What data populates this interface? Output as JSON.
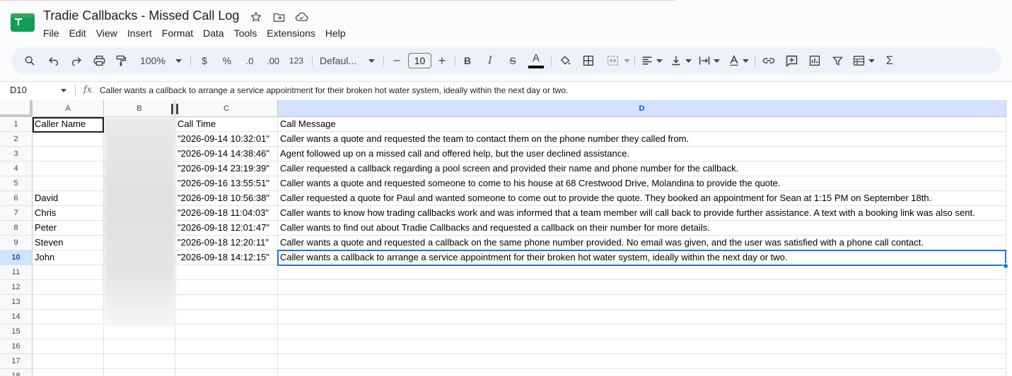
{
  "doc": {
    "title": "Tradie Callbacks - Missed Call Log"
  },
  "menu": [
    "File",
    "Edit",
    "View",
    "Insert",
    "Format",
    "Data",
    "Tools",
    "Extensions",
    "Help"
  ],
  "toolbar": {
    "zoom": "100%",
    "currency": "$",
    "percent": "%",
    "dec_decrease": ".0",
    "dec_increase": ".00",
    "number_format": "123",
    "font": "Defaul...",
    "font_size": "10",
    "minus": "–",
    "plus": "+",
    "bold": "B",
    "italic": "I",
    "strike": "S",
    "text_color": "A",
    "sum": "Σ"
  },
  "formula_bar": {
    "cell_ref": "D10",
    "fx": "fx",
    "content": "Caller wants a callback to arrange a service appointment for their broken hot water system, ideally within the next day or two."
  },
  "columns": [
    "A",
    "B",
    "C",
    "D"
  ],
  "rows": [
    {
      "num": "1",
      "a": "Caller Name",
      "c": "Call Time",
      "d": "Call Message"
    },
    {
      "num": "2",
      "a": "",
      "c": "\"2026-09-14 10:32:01\"",
      "d": "Caller wants a quote and requested the team to contact them on the phone number they called from."
    },
    {
      "num": "3",
      "a": "",
      "c": "\"2026-09-14 14:38:46\"",
      "d": "Agent followed up on a missed call and offered help, but the user declined assistance."
    },
    {
      "num": "4",
      "a": "",
      "c": "\"2026-09-14 23:19:39\"",
      "d": "Caller requested a callback regarding a pool screen and provided their name and phone number for the callback."
    },
    {
      "num": "5",
      "a": "",
      "c": "\"2026-09-16 13:55:51\"",
      "d": "Caller wants a quote and requested someone to come to his house at 68 Crestwood Drive, Molandina to provide the quote."
    },
    {
      "num": "6",
      "a": "David",
      "c": "\"2026-09-18 10:56:38\"",
      "d": "Caller requested a quote for Paul and wanted someone to come out to provide the quote. They booked an appointment for Sean at 1:15 PM on September 18th."
    },
    {
      "num": "7",
      "a": "Chris",
      "c": "\"2026-09-18 11:04:03\"",
      "d": "Caller wants to know how trading callbacks work and was informed that a team member will call back to provide further assistance. A text with a booking link was also sent."
    },
    {
      "num": "8",
      "a": "Peter",
      "c": "\"2026-09-18 12:01:47\"",
      "d": "Caller wants to find out about Tradie Callbacks and requested a callback on their number for more details."
    },
    {
      "num": "9",
      "a": "Steven",
      "c": "\"2026-09-18 12:20:11\"",
      "d": "Caller wants a quote and requested a callback on the same phone number provided. No email was given, and the user was satisfied with a phone call contact."
    },
    {
      "num": "10",
      "a": "John",
      "c": "\"2026-09-18 14:12:15\"",
      "d": "Caller wants a callback to arrange a service appointment for their broken hot water system, ideally within the next day or two."
    },
    {
      "num": "11",
      "a": "",
      "c": "",
      "d": ""
    },
    {
      "num": "12",
      "a": "",
      "c": "",
      "d": ""
    },
    {
      "num": "13",
      "a": "",
      "c": "",
      "d": ""
    },
    {
      "num": "14",
      "a": "",
      "c": "",
      "d": ""
    },
    {
      "num": "15",
      "a": "",
      "c": "",
      "d": ""
    },
    {
      "num": "16",
      "a": "",
      "c": "",
      "d": ""
    },
    {
      "num": "17",
      "a": "",
      "c": "",
      "d": ""
    },
    {
      "num": "18",
      "a": "",
      "c": "",
      "d": ""
    }
  ],
  "selected": {
    "row": "10",
    "column": "D"
  },
  "colors": {
    "selection": "#1a73e8",
    "header_selected_bg": "#d3e3fd",
    "toolbar_bg": "#edf2fa"
  }
}
